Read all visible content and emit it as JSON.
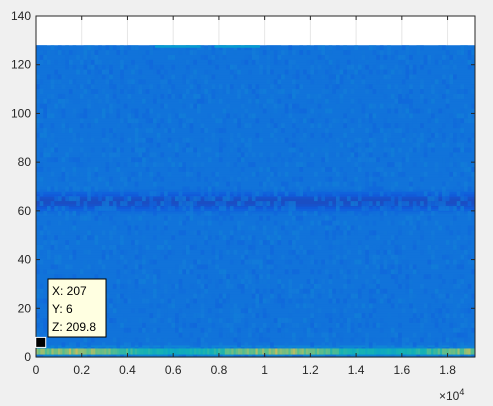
{
  "chart_data": {
    "type": "heatmap",
    "title": "",
    "xlabel": "",
    "ylabel": "",
    "xlim": [
      0,
      19200
    ],
    "ylim": [
      0,
      140
    ],
    "x_ticks": [
      0,
      0.2,
      0.4,
      0.6,
      0.8,
      1,
      1.2,
      1.4,
      1.6,
      1.8
    ],
    "x_tick_labels": [
      "0",
      "0.2",
      "0.4",
      "0.6",
      "0.8",
      "1",
      "1.2",
      "1.4",
      "1.6",
      "1.8"
    ],
    "x_exponent_label": "×10",
    "x_exponent_power": "4",
    "y_ticks": [
      0,
      20,
      40,
      60,
      80,
      100,
      120,
      140
    ],
    "y_tick_labels": [
      "0",
      "20",
      "40",
      "60",
      "80",
      "100",
      "120",
      "140"
    ],
    "grid": true,
    "image_extent": {
      "x": [
        0,
        19200
      ],
      "y": [
        0,
        128
      ]
    },
    "colormap": "parula",
    "background_level": 0.17,
    "features": [
      {
        "name": "dark horizontal band",
        "y_center": 64,
        "level": 0.07
      },
      {
        "name": "bright low-row streak",
        "y_range": [
          1,
          5
        ],
        "level": 0.55
      },
      {
        "name": "bright top edge patches",
        "y": 127.5,
        "level": 0.35
      }
    ],
    "datatip": {
      "x": 207,
      "y": 6,
      "lines": [
        "X: 207",
        "Y: 6",
        "Z: 209.8"
      ]
    }
  },
  "colors": {
    "axes_background": "#ffffff",
    "figure_background": "#f0f0f0",
    "grid": "#e6e6e6",
    "axis": "#262626",
    "tip_background": "#ffffe1",
    "marker": "#000000"
  }
}
